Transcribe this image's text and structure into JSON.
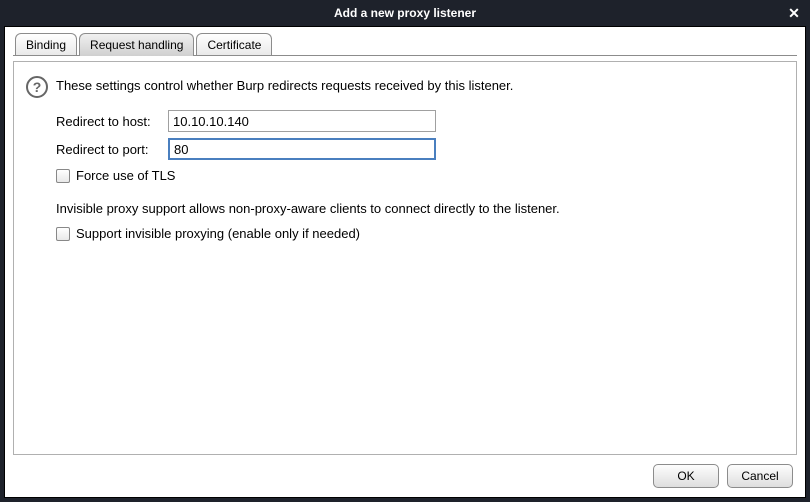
{
  "window": {
    "title": "Add a new proxy listener"
  },
  "tabs": {
    "binding": "Binding",
    "request_handling": "Request handling",
    "certificate": "Certificate"
  },
  "panel": {
    "description": "These settings control whether Burp redirects requests received by this listener.",
    "host_label": "Redirect to host:",
    "host_value": "10.10.10.140",
    "port_label": "Redirect to port:",
    "port_value": "80",
    "force_tls_label": "Force use of TLS",
    "invisible_desc": "Invisible proxy support allows non-proxy-aware clients to connect directly to the listener.",
    "invisible_label": "Support invisible proxying (enable only if needed)"
  },
  "footer": {
    "ok": "OK",
    "cancel": "Cancel"
  }
}
